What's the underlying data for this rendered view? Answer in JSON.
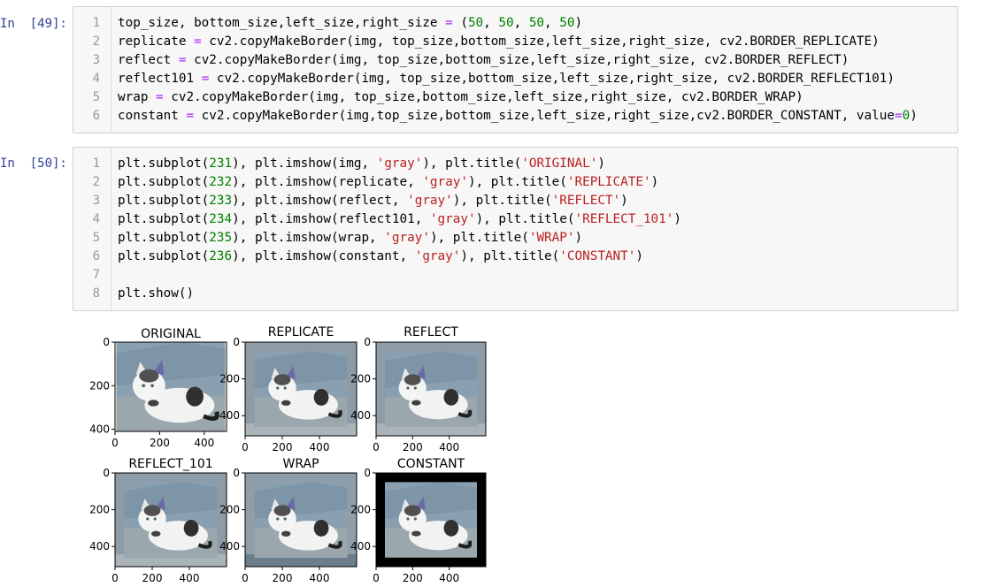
{
  "cells": [
    {
      "prompt": "In  [49]:",
      "line_numbers": [
        "1",
        "2",
        "3",
        "4",
        "5",
        "6"
      ],
      "lines": [
        "top_size, bottom_size,left_size,right_size = (50, 50, 50, 50)",
        "replicate = cv2.copyMakeBorder(img, top_size,bottom_size,left_size,right_size, cv2.BORDER_REPLICATE)",
        "reflect = cv2.copyMakeBorder(img, top_size,bottom_size,left_size,right_size, cv2.BORDER_REFLECT)",
        "reflect101 = cv2.copyMakeBorder(img, top_size,bottom_size,left_size,right_size, cv2.BORDER_REFLECT101)",
        "wrap = cv2.copyMakeBorder(img, top_size,bottom_size,left_size,right_size, cv2.BORDER_WRAP)",
        "constant = cv2.copyMakeBorder(img,top_size,bottom_size,left_size,right_size,cv2.BORDER_CONSTANT, value=0)"
      ]
    },
    {
      "prompt": "In  [50]:",
      "line_numbers": [
        "1",
        "2",
        "3",
        "4",
        "5",
        "6",
        "7",
        "8"
      ],
      "lines": [
        "plt.subplot(231), plt.imshow(img, 'gray'), plt.title('ORIGINAL')",
        "plt.subplot(232), plt.imshow(replicate, 'gray'), plt.title('REPLICATE')",
        "plt.subplot(233), plt.imshow(reflect, 'gray'), plt.title('REFLECT')",
        "plt.subplot(234), plt.imshow(reflect101, 'gray'), plt.title('REFLECT_101')",
        "plt.subplot(235), plt.imshow(wrap, 'gray'), plt.title('WRAP')",
        "plt.subplot(236), plt.imshow(constant, 'gray'), plt.title('CONSTANT')",
        "",
        "plt.show()"
      ]
    }
  ],
  "figure": {
    "subplots": [
      {
        "title": "ORIGINAL",
        "border": "none"
      },
      {
        "title": "REPLICATE",
        "border": "replicate"
      },
      {
        "title": "REFLECT",
        "border": "reflect"
      },
      {
        "title": "REFLECT_101",
        "border": "reflect"
      },
      {
        "title": "WRAP",
        "border": "wrap"
      },
      {
        "title": "CONSTANT",
        "border": "constant"
      }
    ],
    "yticks_original": [
      "0",
      "200",
      "400"
    ],
    "xticks_original": [
      "0",
      "200",
      "400"
    ],
    "yticks_padded": [
      "0",
      "200",
      "400"
    ],
    "xticks_padded": [
      "0",
      "200",
      "400"
    ]
  },
  "colors": {
    "prompt": "#303f9f",
    "cell_bg": "#f7f7f7",
    "cell_border": "#cfcfcf",
    "string": "#ba2121",
    "number": "#008000",
    "operator": "#aa22ff"
  }
}
